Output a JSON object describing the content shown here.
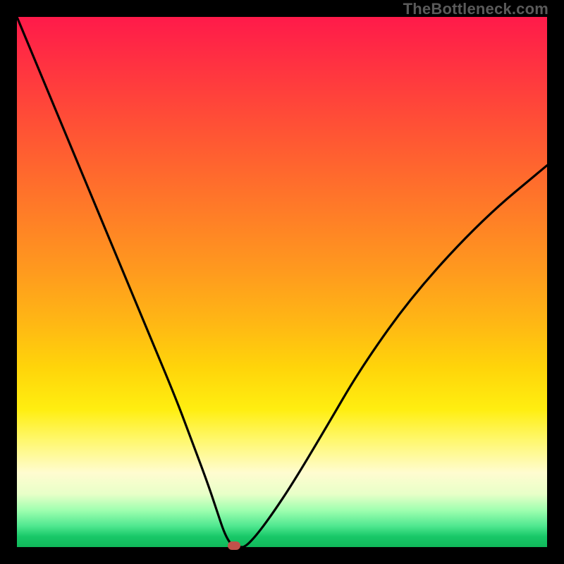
{
  "watermark": "TheBottleneck.com",
  "colors": {
    "frame": "#000000",
    "curve": "#000000",
    "marker": "#c0524a",
    "gradient_top": "#ff1a4a",
    "gradient_bottom": "#10b85a"
  },
  "chart_data": {
    "type": "line",
    "title": "",
    "xlabel": "",
    "ylabel": "",
    "xlim": [
      0,
      100
    ],
    "ylim": [
      0,
      100
    ],
    "minimum_x": 41,
    "marker": {
      "x": 41,
      "y": 0
    },
    "series": [
      {
        "name": "bottleneck-curve",
        "x": [
          0,
          5,
          10,
          15,
          20,
          25,
          30,
          33,
          36,
          38,
          39,
          40,
          41,
          42,
          43,
          45,
          48,
          52,
          58,
          65,
          75,
          88,
          100
        ],
        "y": [
          100,
          88,
          76,
          64,
          52,
          40,
          28,
          20,
          12,
          6,
          3,
          1,
          0,
          0,
          0,
          2,
          6,
          12,
          22,
          34,
          48,
          62,
          72
        ]
      }
    ]
  }
}
